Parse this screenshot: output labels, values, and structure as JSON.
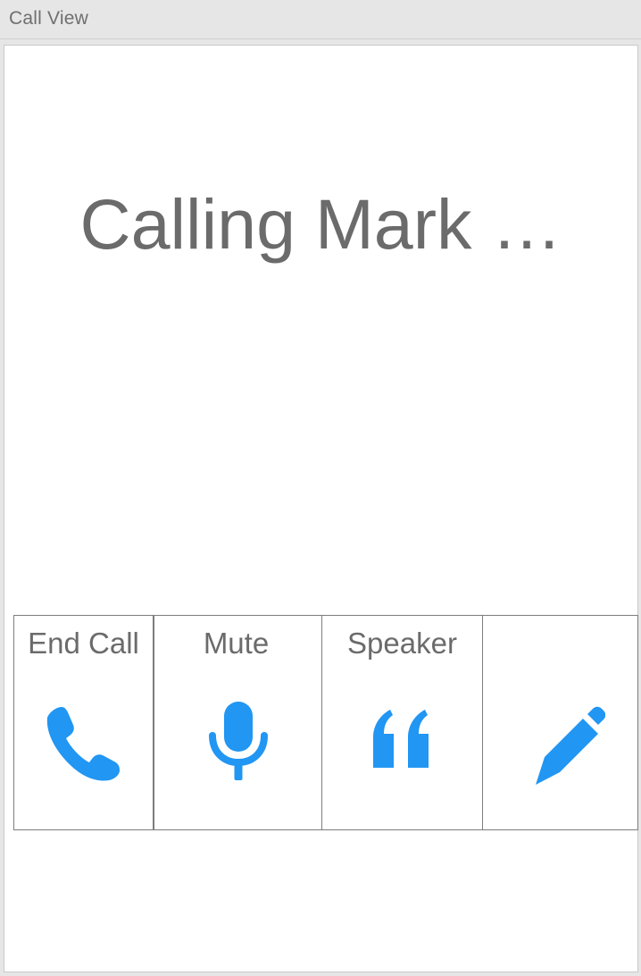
{
  "window": {
    "title": "Call View"
  },
  "call": {
    "status_text": "Calling Mark …"
  },
  "actions": [
    {
      "label": "End Call",
      "icon": "phone-icon"
    },
    {
      "label": "Mute",
      "icon": "microphone-icon"
    },
    {
      "label": "Speaker",
      "icon": "quote-icon"
    },
    {
      "label": "",
      "icon": "pencil-icon"
    }
  ],
  "colors": {
    "accent": "#2196F3",
    "text": "#6b6b6b"
  }
}
